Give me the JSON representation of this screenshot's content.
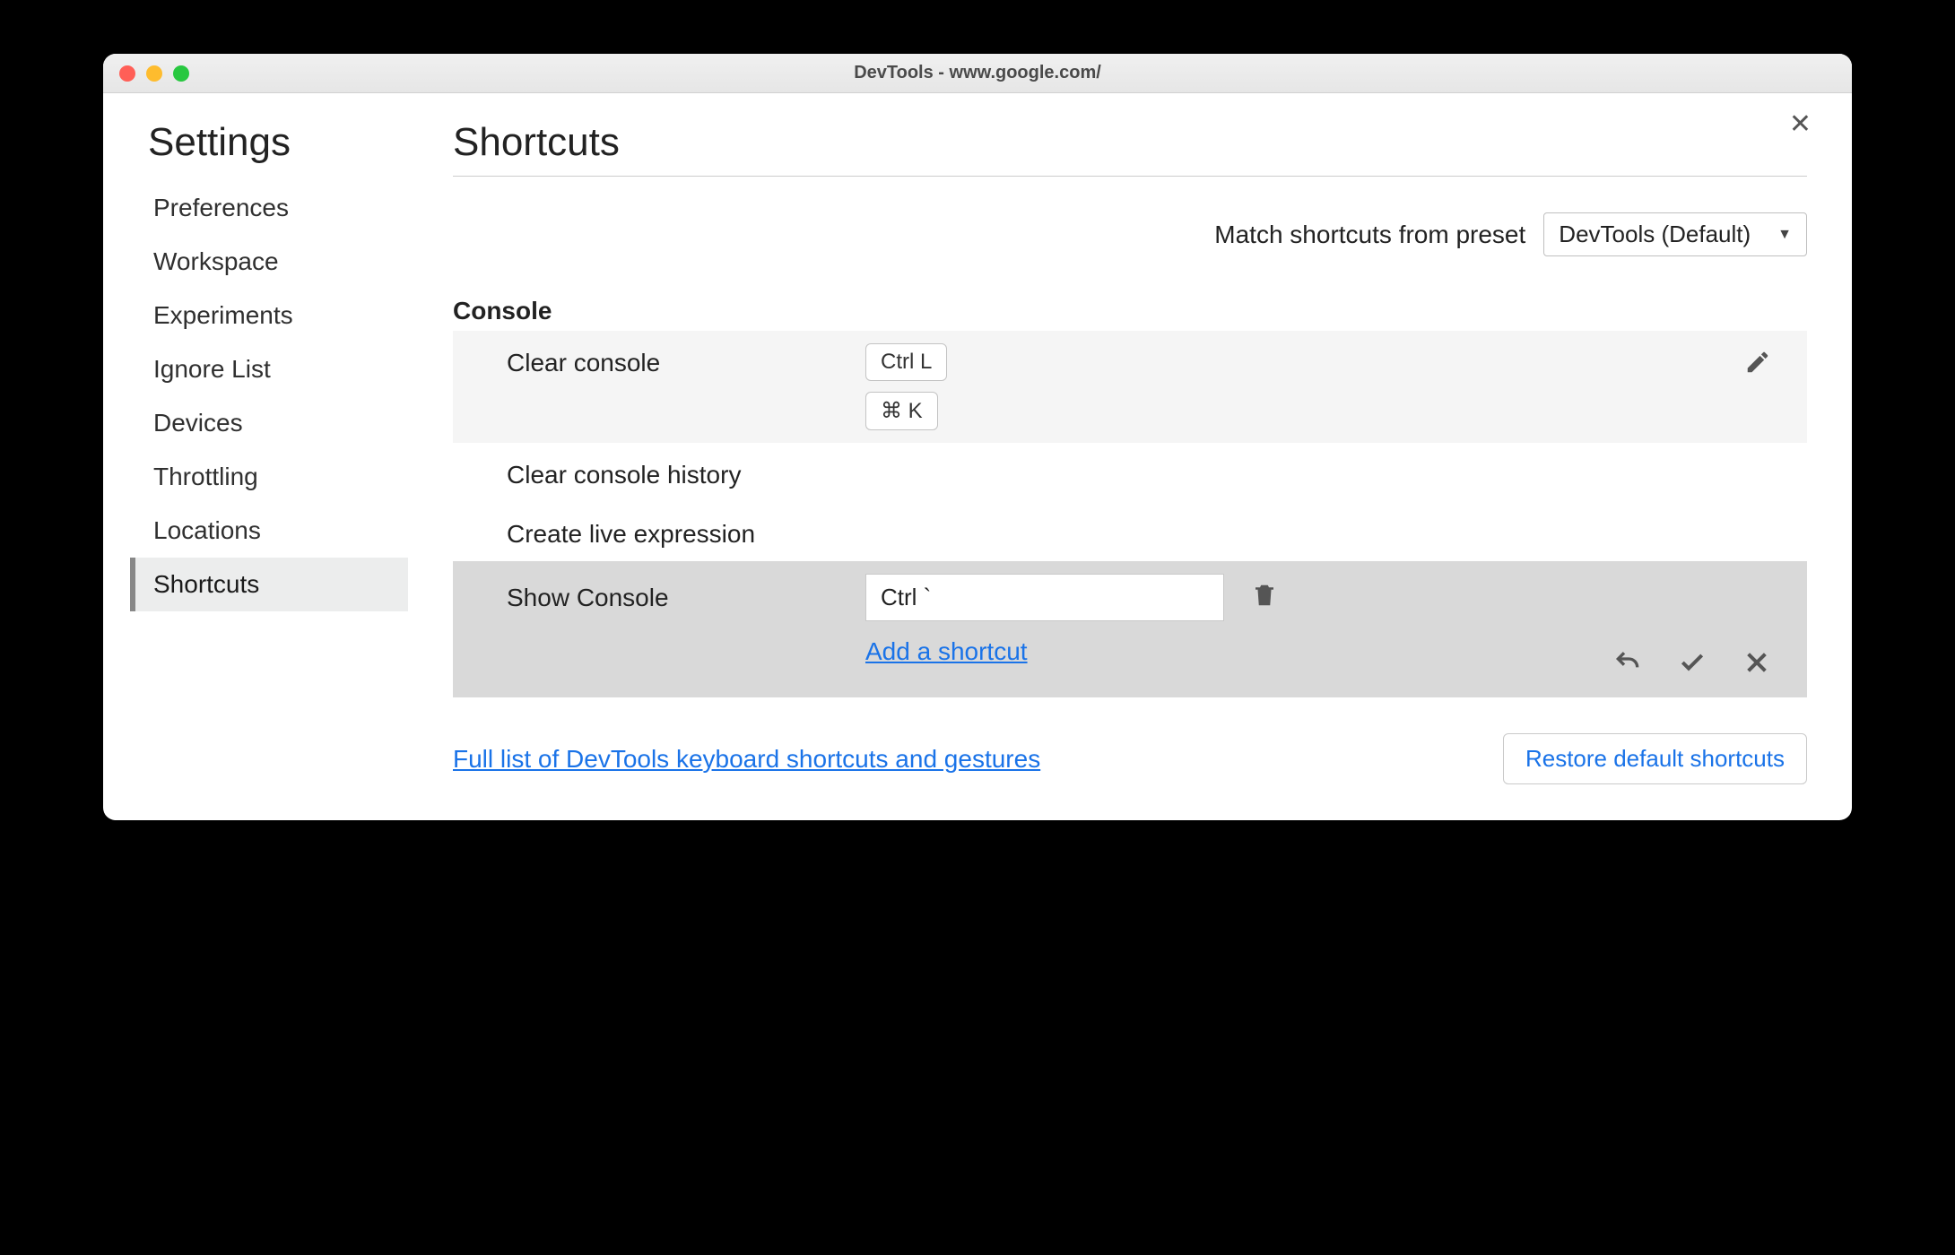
{
  "window": {
    "title": "DevTools - www.google.com/"
  },
  "sidebar": {
    "title": "Settings",
    "items": [
      {
        "label": "Preferences"
      },
      {
        "label": "Workspace"
      },
      {
        "label": "Experiments"
      },
      {
        "label": "Ignore List"
      },
      {
        "label": "Devices"
      },
      {
        "label": "Throttling"
      },
      {
        "label": "Locations"
      },
      {
        "label": "Shortcuts"
      }
    ]
  },
  "main": {
    "title": "Shortcuts",
    "preset_label": "Match shortcuts from preset",
    "preset_value": "DevTools (Default)",
    "section": "Console",
    "rows": {
      "clear_console": {
        "label": "Clear console",
        "keys": [
          "Ctrl L",
          "⌘ K"
        ]
      },
      "clear_history": {
        "label": "Clear console history"
      },
      "create_live": {
        "label": "Create live expression"
      },
      "show_console": {
        "label": "Show Console",
        "input_value": "Ctrl `",
        "add_link": "Add a shortcut"
      }
    },
    "footer_link": "Full list of DevTools keyboard shortcuts and gestures",
    "restore_label": "Restore default shortcuts"
  }
}
